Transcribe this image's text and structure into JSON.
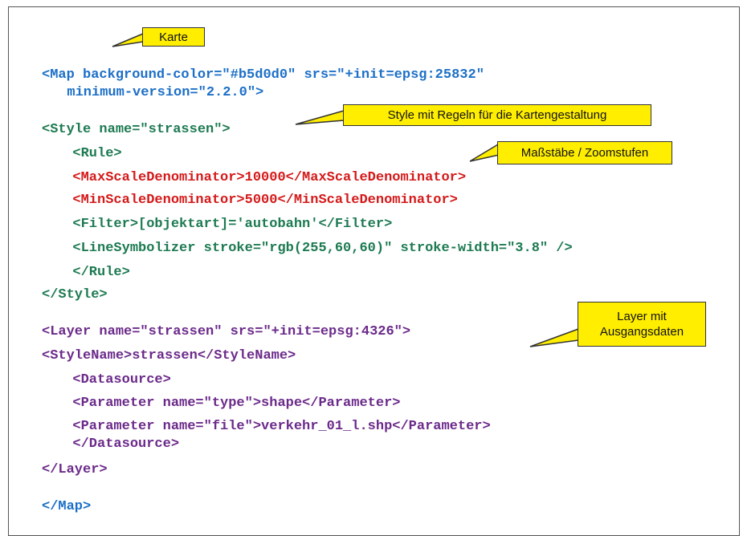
{
  "code_lines": [
    "<Map background-color=\"#b5d0d0\" srs=\"+init=epsg:25832\"",
    "  minimum-version=\"2.2.0\">",
    "<Style name=\"strassen\">",
    "  <Rule>",
    "  <MaxScaleDenominator>10000</MaxScaleDenominator>",
    "  <MinScaleDenominator>5000</MinScaleDenominator>",
    "  <Filter>[objektart]='autobahn'</Filter>",
    "  <LineSymbolizer stroke=\"rgb(255,60,60)\" stroke-width=\"3.8\" />",
    "  </Rule>",
    "</Style>",
    "<Layer name=\"strassen\" srs=\"+init=epsg:4326\">",
    "<StyleName>strassen</StyleName>",
    "  <Datasource>",
    "  <Parameter name=\"type\">shape</Parameter>",
    "  <Parameter name=\"file\">verkehr_01_l.shp</Parameter>",
    "  </Datasource>",
    "</Layer>",
    "</Map>"
  ],
  "callouts": {
    "karte": "Karte",
    "style": "Style mit Regeln für die Kartengestaltung",
    "scales": "Maßstäbe / Zoomstufen",
    "layer_line1": "Layer mit",
    "layer_line2": "Ausgangsdaten"
  },
  "colors": {
    "map": "#1c6fc7",
    "style": "#1d7a52",
    "scale": "#d41a1a",
    "layer": "#6b2a8a",
    "callout": "#ffee00"
  }
}
